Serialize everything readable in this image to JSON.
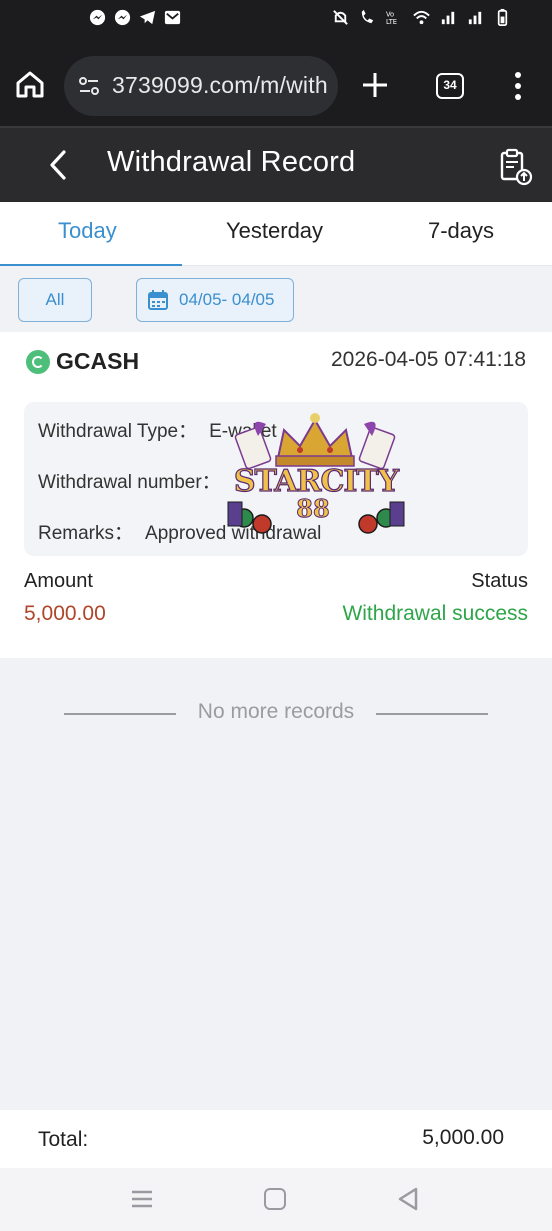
{
  "browser": {
    "url": "3739099.com/m/with",
    "tab_count": "34"
  },
  "header": {
    "title": "Withdrawal Record"
  },
  "tabs": [
    {
      "label": "Today",
      "active": true
    },
    {
      "label": "Yesterday",
      "active": false
    },
    {
      "label": "7-days",
      "active": false
    }
  ],
  "filters": {
    "all_label": "All",
    "date_range": "04/05- 04/05"
  },
  "record": {
    "method": "GCASH",
    "datetime": "2026-04-05 07:41:18",
    "type_label": "Withdrawal Type：",
    "type_value": "E-wallet",
    "number_label": "Withdrawal number：",
    "number_value": "",
    "remarks_label": "Remarks：",
    "remarks_value": "Approved withdrawal",
    "amount_label": "Amount",
    "amount_value": "5,000.00",
    "status_label": "Status",
    "status_value": "Withdrawal success"
  },
  "no_more": "No more records",
  "total": {
    "label": "Total:",
    "value": "5,000.00"
  },
  "watermark": {
    "line1": "STARCITY",
    "line2": "88"
  },
  "colors": {
    "accent": "#3a8fcf",
    "amount": "#b0452a",
    "success": "#2fa54a"
  },
  "icons": [
    "home-icon",
    "tune-icon",
    "plus-icon",
    "tabs-icon",
    "more-vert-icon",
    "back-arrow-icon",
    "record-upload-icon",
    "calendar-icon",
    "gcash-icon",
    "recent-apps-icon",
    "nav-home-icon",
    "nav-back-icon"
  ]
}
